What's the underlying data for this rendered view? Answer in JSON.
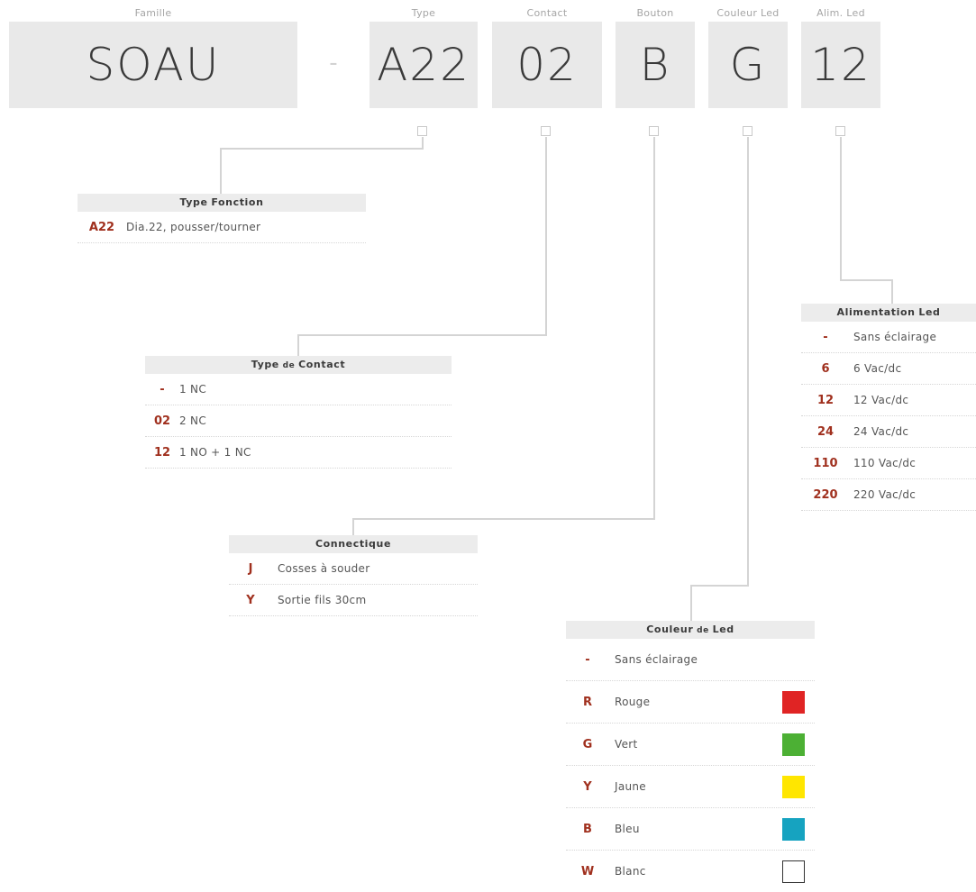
{
  "segments": [
    {
      "id": "famille",
      "label": "Famille",
      "value": "SOAU"
    },
    {
      "id": "type",
      "label": "Type",
      "value": "A22"
    },
    {
      "id": "contact",
      "label": "Contact",
      "value": "02"
    },
    {
      "id": "bouton",
      "label": "Bouton",
      "value": "B"
    },
    {
      "id": "couleur",
      "label": "Couleur Led",
      "value": "G"
    },
    {
      "id": "alim",
      "label": "Alim. Led",
      "value": "12"
    }
  ],
  "separator": "-",
  "tables": {
    "type_fonction": {
      "title": [
        "Type",
        "Fonction"
      ],
      "rows": [
        {
          "code": "A22",
          "desc": "Dia.22, pousser/tourner"
        }
      ]
    },
    "type_contact": {
      "title": [
        "Type",
        "de",
        "Contact"
      ],
      "rows": [
        {
          "code": "-",
          "desc": "1 NC"
        },
        {
          "code": "02",
          "desc": "2 NC"
        },
        {
          "code": "12",
          "desc": "1 NO + 1 NC"
        }
      ]
    },
    "connectique": {
      "title": [
        "Connectique"
      ],
      "rows": [
        {
          "code": "J",
          "desc": "Cosses à souder"
        },
        {
          "code": "Y",
          "desc": "Sortie fils 30cm"
        }
      ]
    },
    "couleur_led": {
      "title": [
        "Couleur",
        "de",
        "Led"
      ],
      "rows": [
        {
          "code": "-",
          "desc": "Sans éclairage",
          "color": ""
        },
        {
          "code": "R",
          "desc": "Rouge",
          "color": "#e02424"
        },
        {
          "code": "G",
          "desc": "Vert",
          "color": "#4cb034"
        },
        {
          "code": "Y",
          "desc": "Jaune",
          "color": "#ffe600"
        },
        {
          "code": "B",
          "desc": "Bleu",
          "color": "#16a3c0"
        },
        {
          "code": "W",
          "desc": "Blanc",
          "color": "#ffffff"
        }
      ]
    },
    "alimentation_led": {
      "title": [
        "Alimentation",
        "Led"
      ],
      "rows": [
        {
          "code": "-",
          "desc": "Sans éclairage"
        },
        {
          "code": "6",
          "desc": "6 Vac/dc"
        },
        {
          "code": "12",
          "desc": "12 Vac/dc"
        },
        {
          "code": "24",
          "desc": "24 Vac/dc"
        },
        {
          "code": "110",
          "desc": "110 Vac/dc"
        },
        {
          "code": "220",
          "desc": "220 Vac/dc"
        }
      ]
    }
  },
  "colors": {
    "code": "#a0301e",
    "box": "#e9e9e9",
    "line": "#d0d0d0"
  }
}
